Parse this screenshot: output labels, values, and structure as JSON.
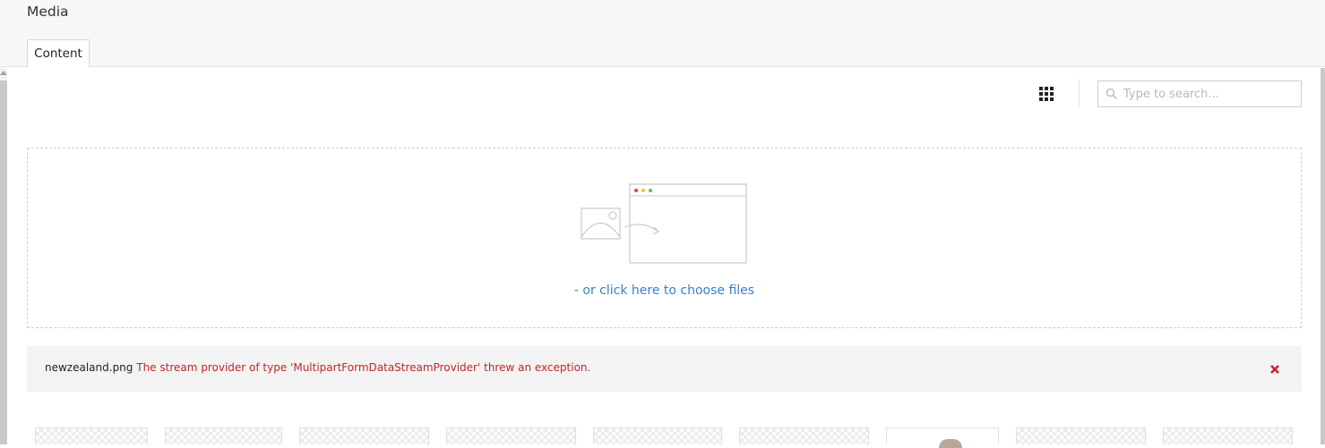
{
  "header": {
    "title": "Media"
  },
  "tabs": [
    {
      "label": "Content"
    }
  ],
  "toolbar": {
    "layout_icon": "grid-icon",
    "search": {
      "placeholder": "Type to search...",
      "value": ""
    }
  },
  "dropzone": {
    "illustration": "upload-illustration",
    "choose_files_label": "- or click here to choose files"
  },
  "error": {
    "filename": "newzealand.png",
    "message": "The stream provider of type 'MultipartFormDataStreamProvider' threw an exception.",
    "close_icon": "close-icon",
    "color": "#c0262c"
  },
  "colors": {
    "accent": "#3a80c6",
    "error": "#c0262c"
  },
  "media_items_visible": 9
}
